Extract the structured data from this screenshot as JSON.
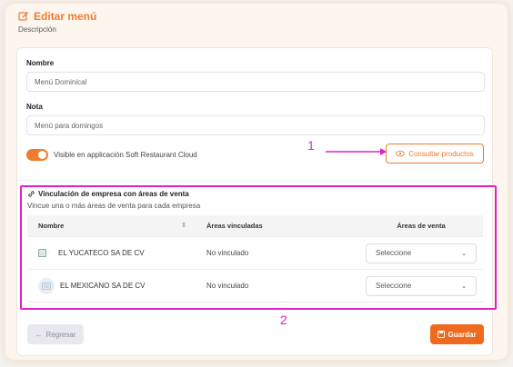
{
  "header": {
    "title": "Editar menú",
    "subtitle": "Descripción"
  },
  "form": {
    "nombre_label": "Nombre",
    "nombre_value": "Menú Dominical",
    "nota_label": "Nota",
    "nota_value": "Menú para domingos",
    "visible_toggle_on": true,
    "visible_label": "Visible en applicación Soft Restaurant Cloud",
    "consult_button": "Consultar productos"
  },
  "annotations": {
    "label1": "1",
    "label2": "2",
    "color": "#e020c8"
  },
  "linking": {
    "title": "Vinculación de empresa con áreas de venta",
    "subtitle": "Vincue una o más áreas de venta para cada empresa",
    "columns": [
      "Nombre",
      "Áreas vinculadas",
      "Áreas de venta"
    ],
    "rows": [
      {
        "name": "EL YUCATECO SA DE CV",
        "areas": "No vinculado",
        "select": "Seleccione"
      },
      {
        "name": "EL MEXICANO SA DE CV",
        "areas": "No vinculado",
        "select": "Seleccione"
      }
    ]
  },
  "footer": {
    "back_button": "Regresar",
    "save_button": "Guardar"
  },
  "colors": {
    "accent": "#ef7b2c",
    "save": "#ef6a1e"
  }
}
